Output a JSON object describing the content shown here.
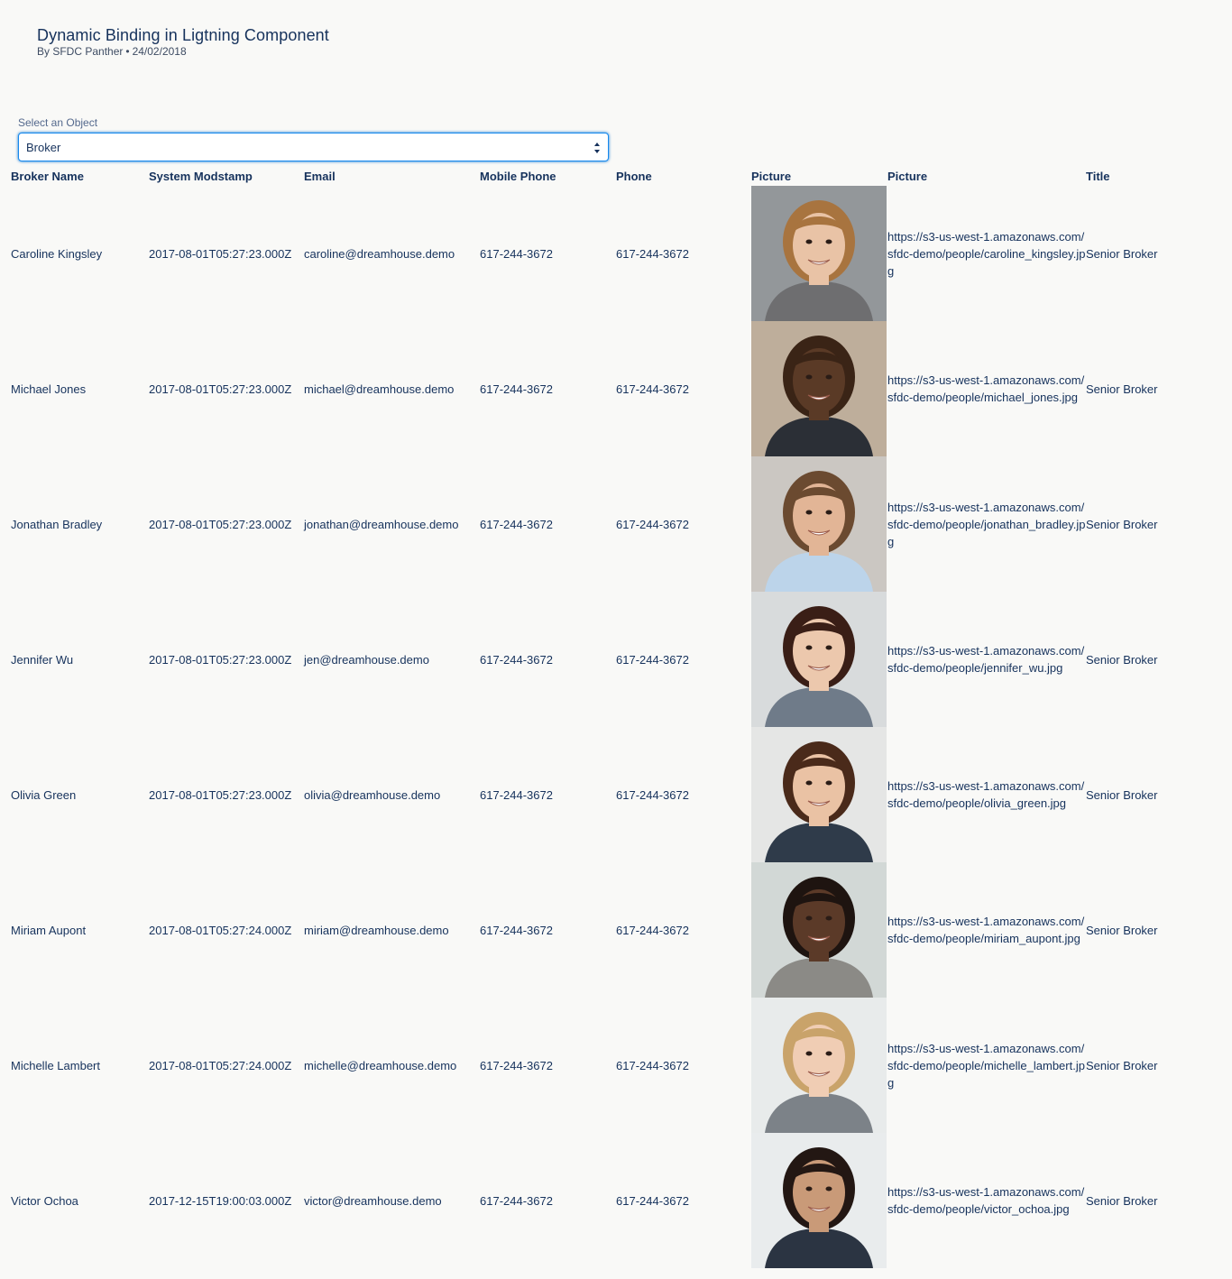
{
  "header": {
    "title": "Dynamic Binding in Ligtning Component",
    "author": "By SFDC Panther",
    "separator": "•",
    "date": "24/02/2018"
  },
  "object_select": {
    "label": "Select an Object",
    "value": "Broker"
  },
  "table": {
    "columns": [
      "Broker Name",
      "System Modstamp",
      "Email",
      "Mobile Phone",
      "Phone",
      "Picture",
      "Picture",
      "Title"
    ],
    "rows": [
      {
        "name": "Caroline Kingsley",
        "stamp": "2017-08-01T05:27:23.000Z",
        "email": "caroline@dreamhouse.demo",
        "mobile": "617-244-3672",
        "phone": "617-244-3672",
        "picture_url": "https://s3-us-west-1.amazonaws.com/sfdc-demo/people/caroline_kingsley.jpg",
        "title": "Senior Broker",
        "photo": {
          "bg": "#8a8f92",
          "skin": "#e9c3a6",
          "hair": "#a8743f",
          "shirt": "#6e6e70"
        }
      },
      {
        "name": "Michael Jones",
        "stamp": "2017-08-01T05:27:23.000Z",
        "email": "michael@dreamhouse.demo",
        "mobile": "617-244-3672",
        "phone": "617-244-3672",
        "picture_url": "https://s3-us-west-1.amazonaws.com/sfdc-demo/people/michael_jones.jpg",
        "title": "Senior Broker",
        "photo": {
          "bg": "#b9a893",
          "skin": "#5a3a26",
          "hair": "#3a2416",
          "shirt": "#2b2f36"
        }
      },
      {
        "name": "Jonathan Bradley",
        "stamp": "2017-08-01T05:27:23.000Z",
        "email": "jonathan@dreamhouse.demo",
        "mobile": "617-244-3672",
        "phone": "617-244-3672",
        "picture_url": "https://s3-us-west-1.amazonaws.com/sfdc-demo/people/jonathan_bradley.jpg",
        "title": "Senior Broker",
        "photo": {
          "bg": "#c7c3bd",
          "skin": "#e2b596",
          "hair": "#6b4a30",
          "shirt": "#bcd4ea"
        }
      },
      {
        "name": "Jennifer Wu",
        "stamp": "2017-08-01T05:27:23.000Z",
        "email": "jen@dreamhouse.demo",
        "mobile": "617-244-3672",
        "phone": "617-244-3672",
        "picture_url": "https://s3-us-west-1.amazonaws.com/sfdc-demo/people/jennifer_wu.jpg",
        "title": "Senior Broker",
        "photo": {
          "bg": "#d5d8da",
          "skin": "#ecc8ad",
          "hair": "#3a1e16",
          "shirt": "#6f7b89"
        }
      },
      {
        "name": "Olivia Green",
        "stamp": "2017-08-01T05:27:23.000Z",
        "email": "olivia@dreamhouse.demo",
        "mobile": "617-244-3672",
        "phone": "617-244-3672",
        "picture_url": "https://s3-us-west-1.amazonaws.com/sfdc-demo/people/olivia_green.jpg",
        "title": "Senior Broker",
        "photo": {
          "bg": "#e3e4e3",
          "skin": "#eac2a4",
          "hair": "#4a2a1a",
          "shirt": "#2f3b4a"
        }
      },
      {
        "name": "Miriam Aupont",
        "stamp": "2017-08-01T05:27:24.000Z",
        "email": "miriam@dreamhouse.demo",
        "mobile": "617-244-3672",
        "phone": "617-244-3672",
        "picture_url": "https://s3-us-west-1.amazonaws.com/sfdc-demo/people/miriam_aupont.jpg",
        "title": "Senior Broker",
        "photo": {
          "bg": "#cfd5d3",
          "skin": "#5b3a28",
          "hair": "#1e1410",
          "shirt": "#8b8a86"
        }
      },
      {
        "name": "Michelle Lambert",
        "stamp": "2017-08-01T05:27:24.000Z",
        "email": "michelle@dreamhouse.demo",
        "mobile": "617-244-3672",
        "phone": "617-244-3672",
        "picture_url": "https://s3-us-west-1.amazonaws.com/sfdc-demo/people/michelle_lambert.jpg",
        "title": "Senior Broker",
        "photo": {
          "bg": "#e6eaea",
          "skin": "#f0cdb4",
          "hair": "#c9a36a",
          "shirt": "#7c8288"
        }
      },
      {
        "name": "Victor Ochoa",
        "stamp": "2017-12-15T19:00:03.000Z",
        "email": "victor@dreamhouse.demo",
        "mobile": "617-244-3672",
        "phone": "617-244-3672",
        "picture_url": "https://s3-us-west-1.amazonaws.com/sfdc-demo/people/victor_ochoa.jpg",
        "title": "Senior Broker",
        "photo": {
          "bg": "#e8ebec",
          "skin": "#c99a78",
          "hair": "#231713",
          "shirt": "#2b3442"
        }
      }
    ]
  },
  "colors": {
    "page_bg": "#f9f9f7",
    "text": "#16325c",
    "focus_border": "#1589ee"
  }
}
